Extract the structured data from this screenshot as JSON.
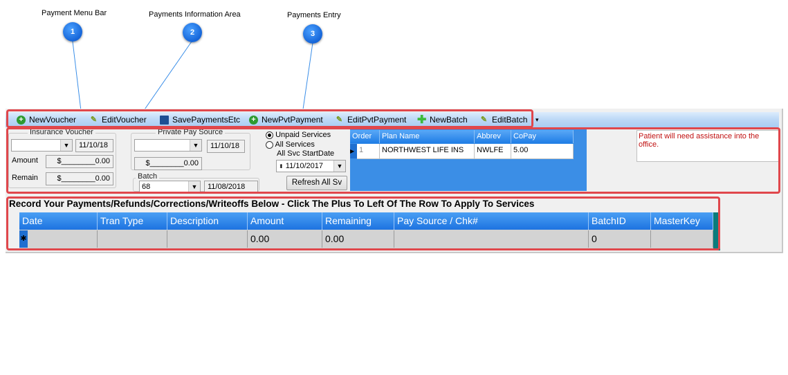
{
  "callouts": [
    {
      "num": "1",
      "label": "Payment Menu Bar"
    },
    {
      "num": "2",
      "label": "Payments Information Area"
    },
    {
      "num": "3",
      "label": "Payments Entry"
    }
  ],
  "menu": {
    "new_voucher": "NewVoucher",
    "edit_voucher": "EditVoucher",
    "save_payments": "SavePaymentsEtc",
    "new_pvt_payment": "NewPvtPayment",
    "edit_pvt_payment": "EditPvtPayment",
    "new_batch": "NewBatch",
    "edit_batch": "EditBatch",
    "overflow": "▾"
  },
  "insurance_voucher": {
    "title": "Insurance Voucher",
    "date": "11/10/18",
    "amount_label": "Amount",
    "amount_value": "$________0.00",
    "remain_label": "Remain",
    "remain_value": "$________0.00"
  },
  "private_pay": {
    "title": "Private Pay Source",
    "date": "11/10/18",
    "amount_value": "$________0.00"
  },
  "batch": {
    "label": "Batch",
    "selected": "68",
    "date": "11/08/2018"
  },
  "services": {
    "unpaid_label": "Unpaid Services",
    "all_label": "All Services",
    "start_label": "All Svc StartDate",
    "start_date": "11/10/2017",
    "refresh_label": "Refresh All Sv"
  },
  "plans_grid": {
    "headers": [
      "Order",
      "Plan Name",
      "Abbrev",
      "CoPay"
    ],
    "row": [
      "1",
      "NORTHWEST LIFE INS",
      "NWLFE",
      "5.00"
    ]
  },
  "note": "Patient will need assistance into the office.",
  "payments": {
    "title": "Record Your Payments/Refunds/Corrections/Writeoffs Below - Click The Plus To Left Of The Row To Apply To Services",
    "headers": [
      "Date",
      "Tran Type",
      "Description",
      "Amount",
      "Remaining",
      "Pay Source / Chk#",
      "BatchID",
      "MasterKey"
    ],
    "new_row": [
      "",
      "",
      "",
      "0.00",
      "0.00",
      "",
      "0",
      ""
    ],
    "new_row_marker": "✱"
  },
  "colors": {
    "callout_blue": "#1565d8",
    "highlight_red": "#e0474c",
    "grid_header_blue": "#1f7de6",
    "teal_background": "#0a7c7c",
    "note_red": "#c01010"
  }
}
